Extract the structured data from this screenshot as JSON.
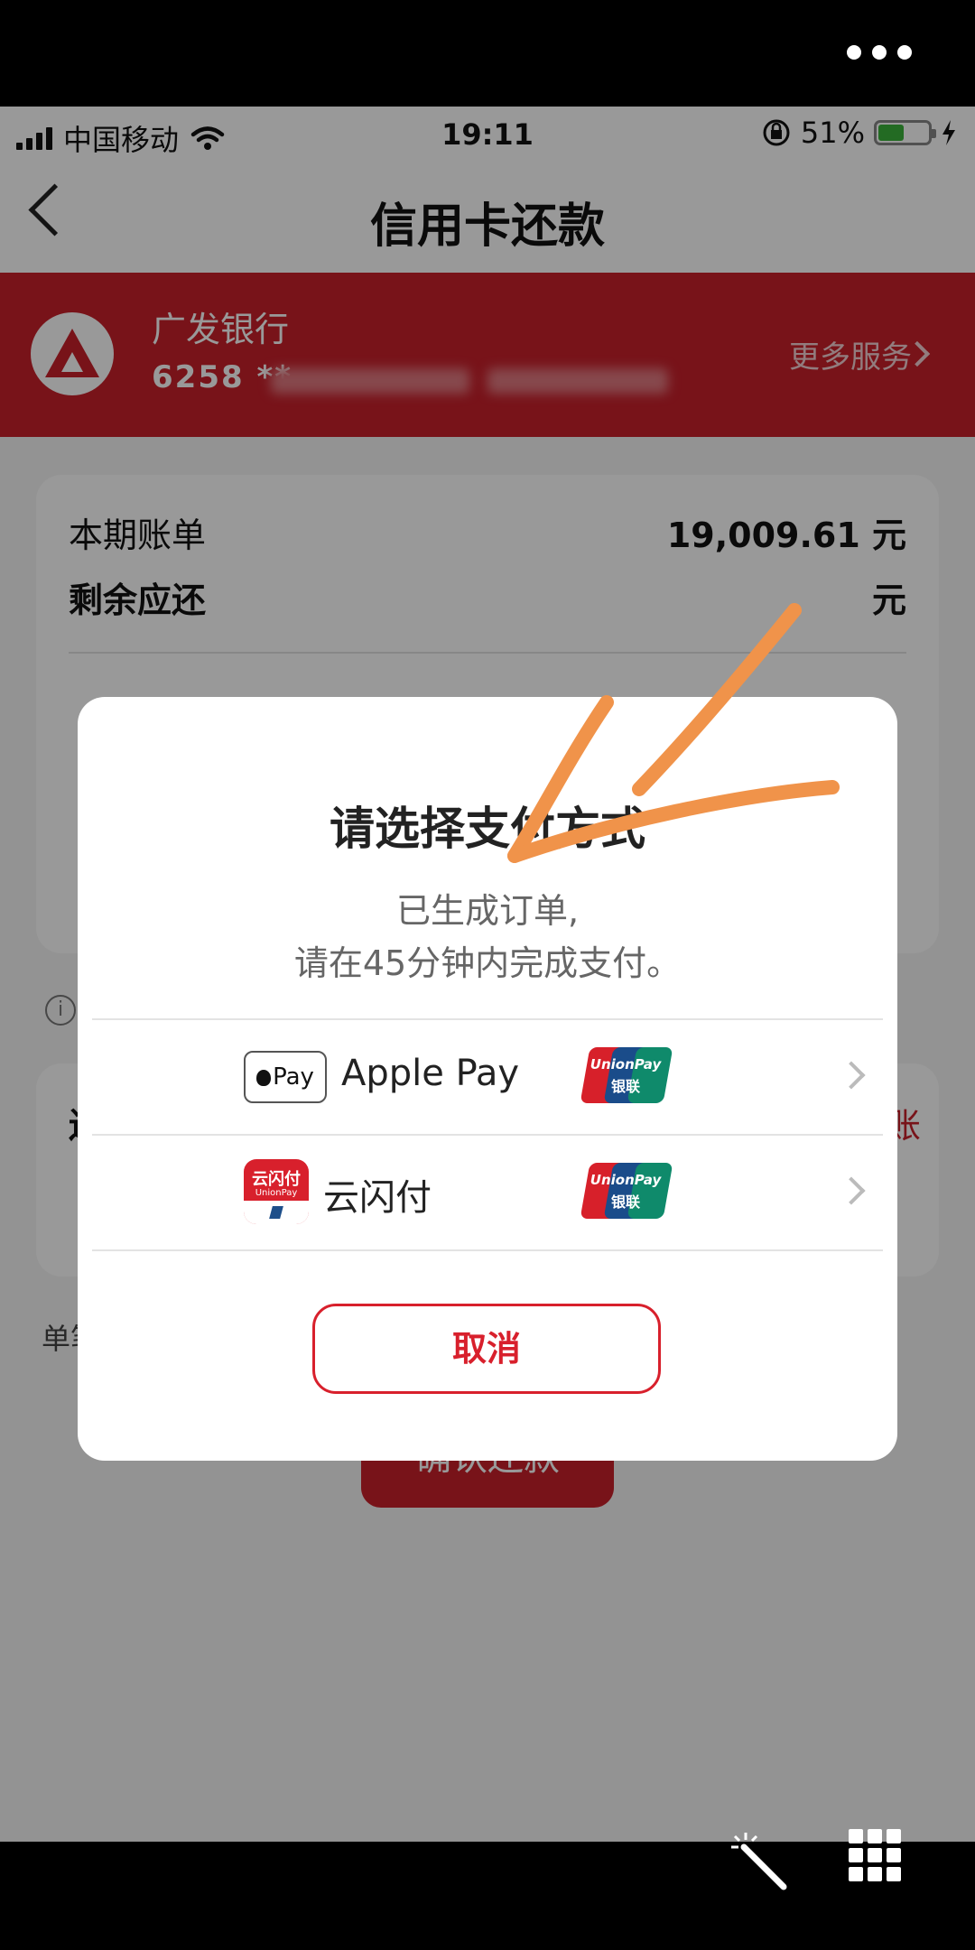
{
  "status_bar": {
    "carrier": "中国移动",
    "time": "19:11",
    "battery": "51%",
    "battery_level": 0.51
  },
  "navbar": {
    "title": "信用卡还款"
  },
  "bank": {
    "name": "广发银行",
    "card_number": "6258 **",
    "more_services": "更多服务"
  },
  "bill": {
    "current_label": "本期账单",
    "current_amount": "19,009.61 元",
    "remaining_label": "剩余应还",
    "remaining_unit": "元"
  },
  "repay": {
    "label": "还",
    "right": "账"
  },
  "bottom_note": "单笔",
  "confirm_button": "确认还款",
  "dialog": {
    "title": "请选择支付方式",
    "subtitle_1": "已生成订单,",
    "subtitle_2": "请在45分钟内完成支付。",
    "methods": [
      {
        "badge": "Pay",
        "label": "Apple Pay",
        "network_top": "UnionPay",
        "network_bottom": "银联"
      },
      {
        "badge_top": "云闪付",
        "badge_bottom": "UnionPay",
        "label": "云闪付",
        "network_top": "UnionPay",
        "network_bottom": "银联"
      }
    ],
    "cancel": "取消"
  },
  "colors": {
    "brand_red": "#c8202b",
    "annotation_orange": "#f0934a"
  }
}
